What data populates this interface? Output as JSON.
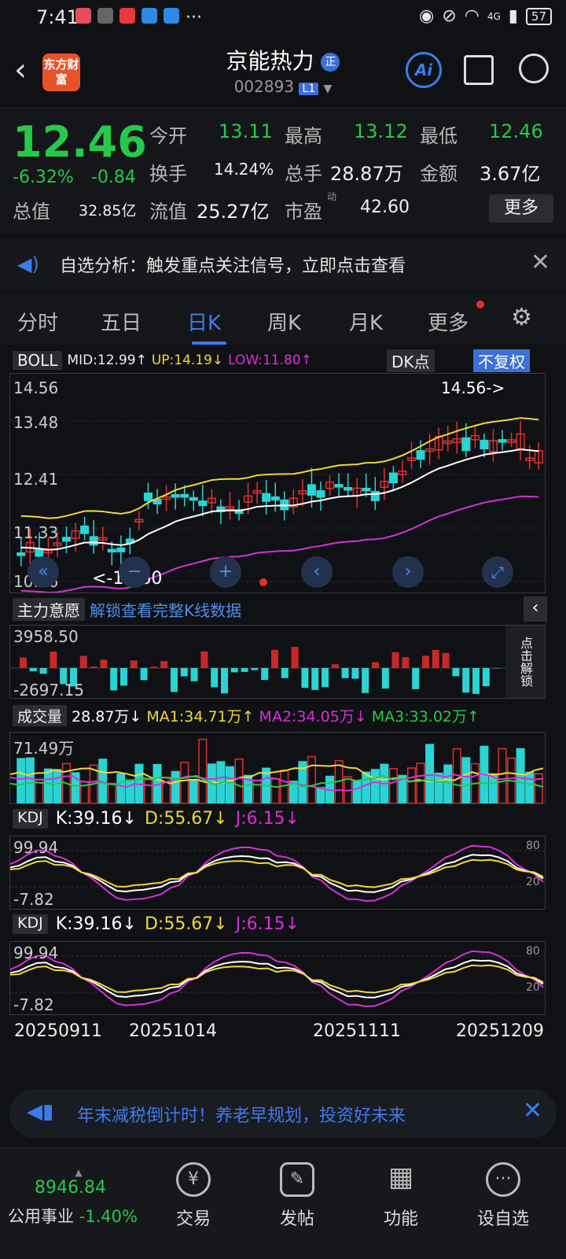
{
  "status": {
    "time": "7:41",
    "network": "4G",
    "battery": "57"
  },
  "header": {
    "title": "京能热力",
    "title_badge": "正",
    "code": "002893",
    "level": "L1",
    "logo_text": "东方财富",
    "ai_label": "Ai"
  },
  "quote": {
    "price": "12.46",
    "change_pct": "-6.32%",
    "change": "-0.84",
    "open_label": "今开",
    "open": "13.11",
    "high_label": "最高",
    "high": "13.12",
    "low_label": "最低",
    "low": "12.46",
    "turnover_label": "换手",
    "turnover": "14.24%",
    "vol_label": "总手",
    "vol": "28.87万",
    "amount_label": "金额",
    "amount": "3.67亿",
    "mktcap_label": "总值",
    "mktcap": "32.85亿",
    "float_label": "流值",
    "float": "25.27亿",
    "pe_label": "市盈",
    "pe_sup": "动",
    "pe": "42.60",
    "more": "更多"
  },
  "notice": {
    "text": "自选分析：触发重点关注信号，立即点击查看"
  },
  "tabs": [
    "分时",
    "五日",
    "日K",
    "周K",
    "月K",
    "更多"
  ],
  "boll": {
    "label": "BOLL",
    "mid": "MID:12.99↑",
    "up": "UP:14.19↓",
    "low": "LOW:11.80↑",
    "dk": "DK点",
    "fq": "不复权",
    "y_labels": [
      "14.56",
      "13.48",
      "12.41",
      "11.33",
      "10.26"
    ],
    "max_mark": "14.56->",
    "min_mark": "<-10.60"
  },
  "main_force": {
    "label": "主力意愿",
    "unlock": "解锁查看完整K线数据",
    "top": "3958.50",
    "bottom": "-2697.15",
    "side": "点击解锁"
  },
  "volume": {
    "label": "成交量",
    "v": "28.87万↓",
    "ma1": "MA1:34.71万↑",
    "ma2": "MA2:34.05万↓",
    "ma3": "MA3:33.02万↑",
    "top": "71.49万"
  },
  "kdj1": {
    "label": "KDJ",
    "k": "K:39.16↓",
    "d": "D:55.67↓",
    "j": "J:6.15↓",
    "top": "99.94",
    "bottom": "-7.82",
    "r80": "80",
    "r20": "20"
  },
  "kdj2": {
    "label": "KDJ",
    "k": "K:39.16↓",
    "d": "D:55.67↓",
    "j": "J:6.15↓",
    "top": "99.94",
    "bottom": "-7.82",
    "r80": "80",
    "r20": "20"
  },
  "dates": [
    "20250911",
    "20251014",
    "20251111",
    "20251209"
  ],
  "ad": {
    "text": "年末减税倒计时！养老早规划，投资好未来"
  },
  "bottom": {
    "index_value": "8946.84",
    "index_name": "公用事业",
    "index_chg": "-1.40%",
    "items": [
      "交易",
      "发帖",
      "功能",
      "设自选"
    ]
  },
  "colors": {
    "up": "#e03030",
    "down": "#27c94a",
    "accent": "#3d7be8"
  }
}
